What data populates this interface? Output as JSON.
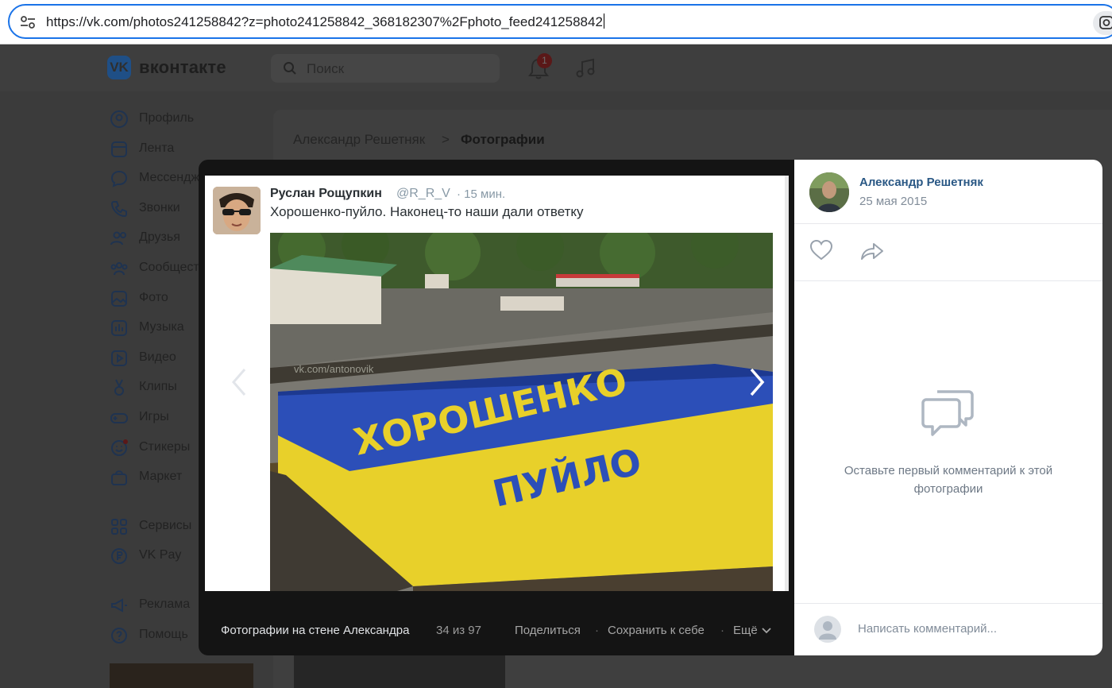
{
  "browser": {
    "url": "https://vk.com/photos241258842?z=photo241258842_368182307%2Fphoto_feed241258842",
    "site_info_icon": "tune-icon",
    "lens_icon": "google-lens-icon"
  },
  "vk_header": {
    "logo_text": "VK",
    "wordmark": "вконтакте",
    "search_placeholder": "Поиск",
    "notifications_badge": "1"
  },
  "sidebar": {
    "items": [
      {
        "label": "Профиль",
        "icon": "user-icon"
      },
      {
        "label": "Лента",
        "icon": "news-icon"
      },
      {
        "label": "Мессенджер",
        "icon": "message-icon"
      },
      {
        "label": "Звонки",
        "icon": "phone-icon"
      },
      {
        "label": "Друзья",
        "icon": "friends-icon"
      },
      {
        "label": "Сообщества",
        "icon": "groups-icon"
      },
      {
        "label": "Фото",
        "icon": "photo-icon"
      },
      {
        "label": "Музыка",
        "icon": "music-icon"
      },
      {
        "label": "Видео",
        "icon": "video-icon"
      },
      {
        "label": "Клипы",
        "icon": "clips-icon"
      },
      {
        "label": "Игры",
        "icon": "gamepad-icon"
      },
      {
        "label": "Стикеры",
        "icon": "sticker-icon"
      },
      {
        "label": "Маркет",
        "icon": "bag-icon"
      }
    ],
    "items2": [
      {
        "label": "Сервисы",
        "icon": "services-icon"
      },
      {
        "label": "VK Pay",
        "icon": "vkpay-icon"
      }
    ],
    "items3": [
      {
        "label": "Реклама",
        "icon": "megaphone-icon"
      },
      {
        "label": "Помощь",
        "icon": "help-icon"
      }
    ]
  },
  "breadcrumb": {
    "user": "Александр Решетняк",
    "separator": ">",
    "current": "Фотографии"
  },
  "tweet": {
    "name": "Руслан Рощупкин",
    "handle": "@R_R_V",
    "time": "· 15 мин.",
    "text": "Хорошенко-пуйло. Наконец-то наши дали  ответку",
    "flag_line1": "ХОРОШЕНКО",
    "flag_line2": "ПУЙЛО",
    "watermark": "vk.com/antonovik"
  },
  "viewer_footer": {
    "album": "Фотографии на стене Александра",
    "counter": "34 из 97",
    "share": "Поделиться",
    "save": "Сохранить к себе",
    "more": "Ещё",
    "separator": "·"
  },
  "right_panel": {
    "author": "Александр Решетняк",
    "date": "25 мая 2015",
    "empty_comments": "Оставьте первый комментарий к этой фотографии",
    "comment_placeholder": "Написать комментарий..."
  },
  "colors": {
    "accent_blue": "#1a73e8",
    "vk_link": "#2a5885",
    "flag_blue": "#2c4fb8",
    "flag_yellow": "#e8d02a"
  }
}
